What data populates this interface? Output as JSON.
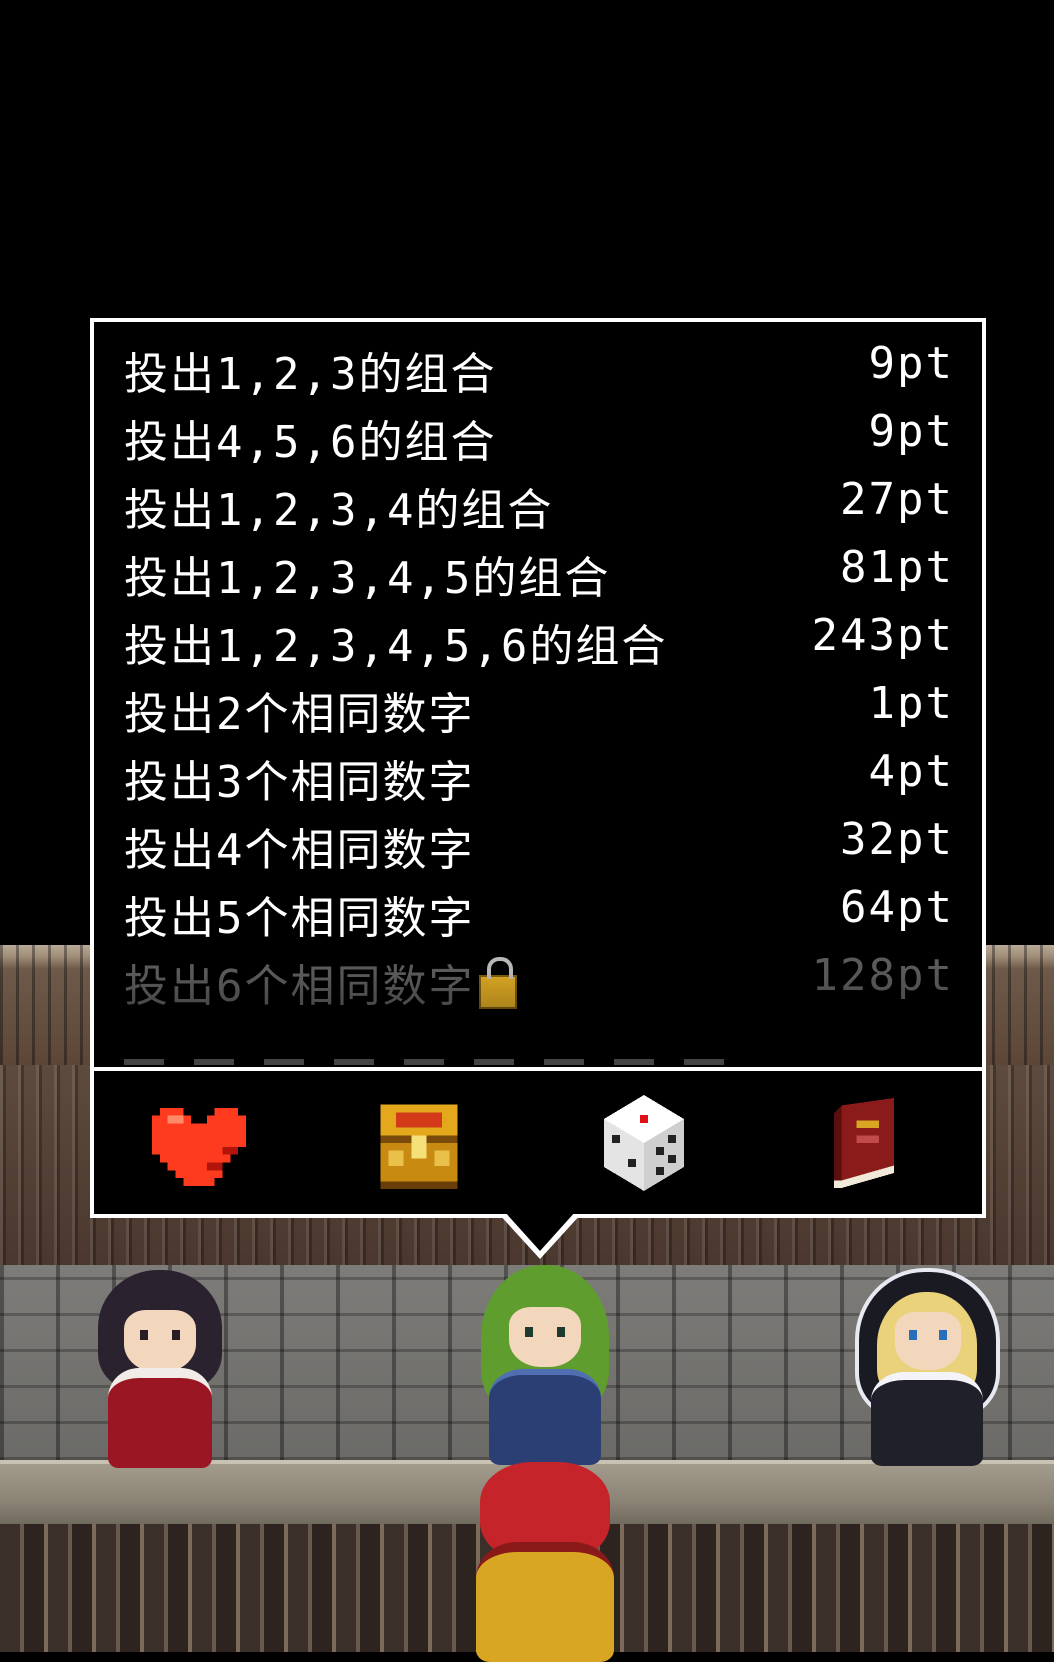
{
  "score_list": {
    "rows": [
      {
        "label": "投出1,2,3的组合",
        "points": "9pt",
        "locked": false
      },
      {
        "label": "投出4,5,6的组合",
        "points": "9pt",
        "locked": false
      },
      {
        "label": "投出1,2,3,4的组合",
        "points": "27pt",
        "locked": false
      },
      {
        "label": "投出1,2,3,4,5的组合",
        "points": "81pt",
        "locked": false
      },
      {
        "label": "投出1,2,3,4,5,6的组合",
        "points": "243pt",
        "locked": false
      },
      {
        "label": "投出2个相同数字",
        "points": "1pt",
        "locked": false
      },
      {
        "label": "投出3个相同数字",
        "points": "4pt",
        "locked": false
      },
      {
        "label": "投出4个相同数字",
        "points": "32pt",
        "locked": false
      },
      {
        "label": "投出5个相同数字",
        "points": "64pt",
        "locked": false
      },
      {
        "label": "投出6个相同数字",
        "points": "128pt",
        "locked": true
      }
    ]
  },
  "toolbar": {
    "items": [
      {
        "icon": "heart-icon",
        "color": "#ff3b1f"
      },
      {
        "icon": "treasure-chest-icon",
        "color": "#e3a81c"
      },
      {
        "icon": "dice-icon",
        "color": "#ffffff"
      },
      {
        "icon": "book-icon",
        "color": "#8b1a1a"
      }
    ]
  },
  "colors": {
    "panel_border": "#ffffff",
    "panel_bg": "#000000",
    "text": "#ffffff",
    "locked_text": "#5a5a5a"
  }
}
